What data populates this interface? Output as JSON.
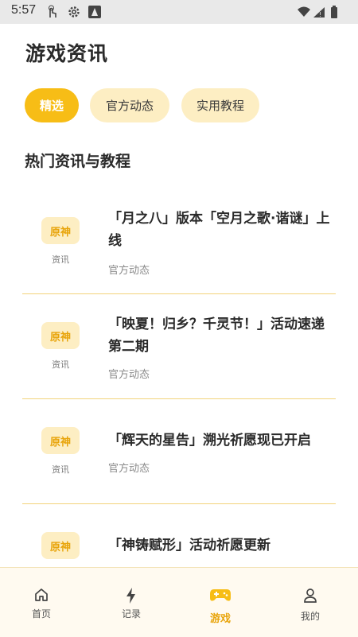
{
  "status": {
    "time": "5:57"
  },
  "page": {
    "title": "游戏资讯"
  },
  "tabs": [
    {
      "label": "精选",
      "active": true
    },
    {
      "label": "官方动态",
      "active": false
    },
    {
      "label": "实用教程",
      "active": false
    }
  ],
  "section": {
    "title": "热门资讯与教程"
  },
  "articles": [
    {
      "tag": "原神",
      "type": "资讯",
      "title": "「月之八」版本「空月之歌·谐谜」上线",
      "source": "官方动态"
    },
    {
      "tag": "原神",
      "type": "资讯",
      "title": "「映夏！归乡？千灵节！」活动速递第二期",
      "source": "官方动态"
    },
    {
      "tag": "原神",
      "type": "资讯",
      "title": "「辉天的星告」溯光祈愿现已开启",
      "source": "官方动态"
    },
    {
      "tag": "原神",
      "type": "",
      "title": "「神铸赋形」活动祈愿更新",
      "source": ""
    }
  ],
  "nav": [
    {
      "label": "首页",
      "icon": "home-icon"
    },
    {
      "label": "记录",
      "icon": "bolt-icon"
    },
    {
      "label": "游戏",
      "icon": "gamepad-icon",
      "active": true
    },
    {
      "label": "我的",
      "icon": "person-icon"
    }
  ],
  "colors": {
    "accent": "#f7bd16",
    "chip_bg": "#fdeec3",
    "divider": "#f2d37a"
  }
}
